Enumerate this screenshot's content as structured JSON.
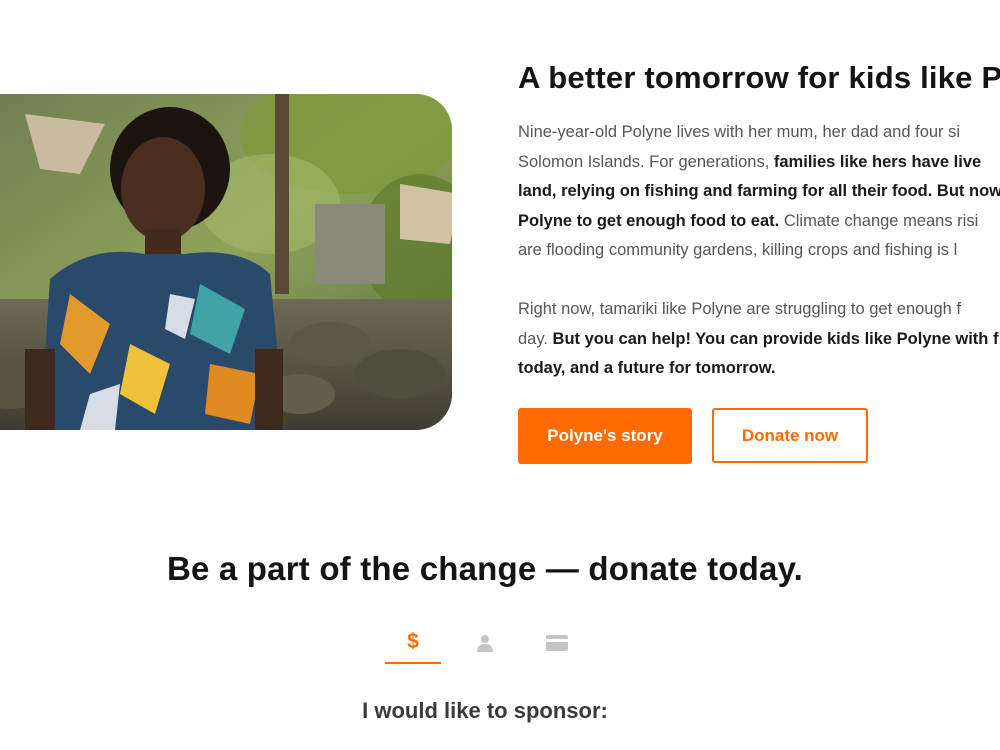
{
  "hero": {
    "title": "A better tomorrow for kids like P",
    "photo_alt": "Young girl in a colourful floral dress standing in front of a rock wall",
    "paragraph1": {
      "line1": "Nine-year-old Polyne lives with her mum, her dad and four si",
      "line2_plain": "Solomon Islands. For generations, ",
      "line2_bold": "families like hers have live",
      "line3_bold": "land, relying on fishing and farming for all their food. But now",
      "line4_bold": "Polyne to get enough food to eat.",
      "line4_plain": " Climate change means risi",
      "line5": "are flooding community gardens, killing crops and fishing is l"
    },
    "paragraph2": {
      "line1": "Right now, tamariki like Polyne are struggling to get enough f",
      "line2_plain": "day. ",
      "line2_bold": "But you can help! You can provide kids like Polyne with f",
      "line3_bold": "today, and a future for tomorrow."
    },
    "buttons": {
      "story": "Polyne's story",
      "donate": "Donate now"
    }
  },
  "donate": {
    "title": "Be a part of the change — donate today.",
    "steps": [
      {
        "icon": "dollar-icon",
        "symbol": "$",
        "active": true
      },
      {
        "icon": "user-icon",
        "active": false
      },
      {
        "icon": "credit-card-icon",
        "active": false
      }
    ],
    "sponsor_label": "I would like to sponsor:"
  },
  "colors": {
    "accent": "#ff6b00",
    "icon_inactive": "#c4c4c4",
    "body_text": "#555555",
    "heading": "#141414"
  }
}
